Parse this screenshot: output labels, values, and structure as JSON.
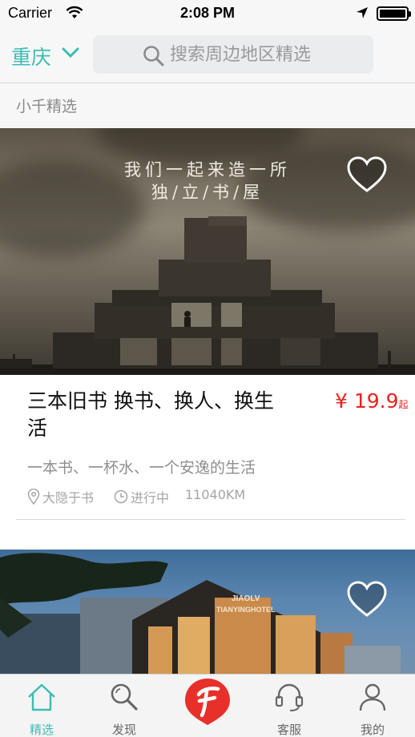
{
  "status_bar": {
    "carrier": "Carrier",
    "time": "2:08 PM"
  },
  "header": {
    "city": "重庆",
    "search_placeholder": "搜索周边地区精选"
  },
  "section": {
    "title": "小千精选"
  },
  "cards": [
    {
      "image_overlay_line1": "我们一起来造一所",
      "image_overlay_line2": "独/立/书/屋",
      "title": "三本旧书 换书、换人、换生活",
      "price": "¥ 19.9",
      "price_suffix": "起",
      "subtitle": "一本书、一杯水、一个安逸的生活",
      "location": "大隐于书",
      "status": "进行中",
      "distance": "11040KM"
    },
    {
      "hotel_sign_line1": "JIAOLV",
      "hotel_sign_line2": "TIANYINGHOTEL"
    }
  ],
  "tabbar": {
    "tabs": [
      {
        "label": "精选",
        "icon": "home-icon",
        "active": true
      },
      {
        "label": "发现",
        "icon": "search-icon"
      },
      {
        "label": "",
        "icon": "app-logo-icon"
      },
      {
        "label": "客服",
        "icon": "headset-icon"
      },
      {
        "label": "我的",
        "icon": "user-icon"
      }
    ]
  },
  "colors": {
    "accent": "#3dbdb3",
    "price": "#e8231f",
    "logo": "#e8302a"
  }
}
